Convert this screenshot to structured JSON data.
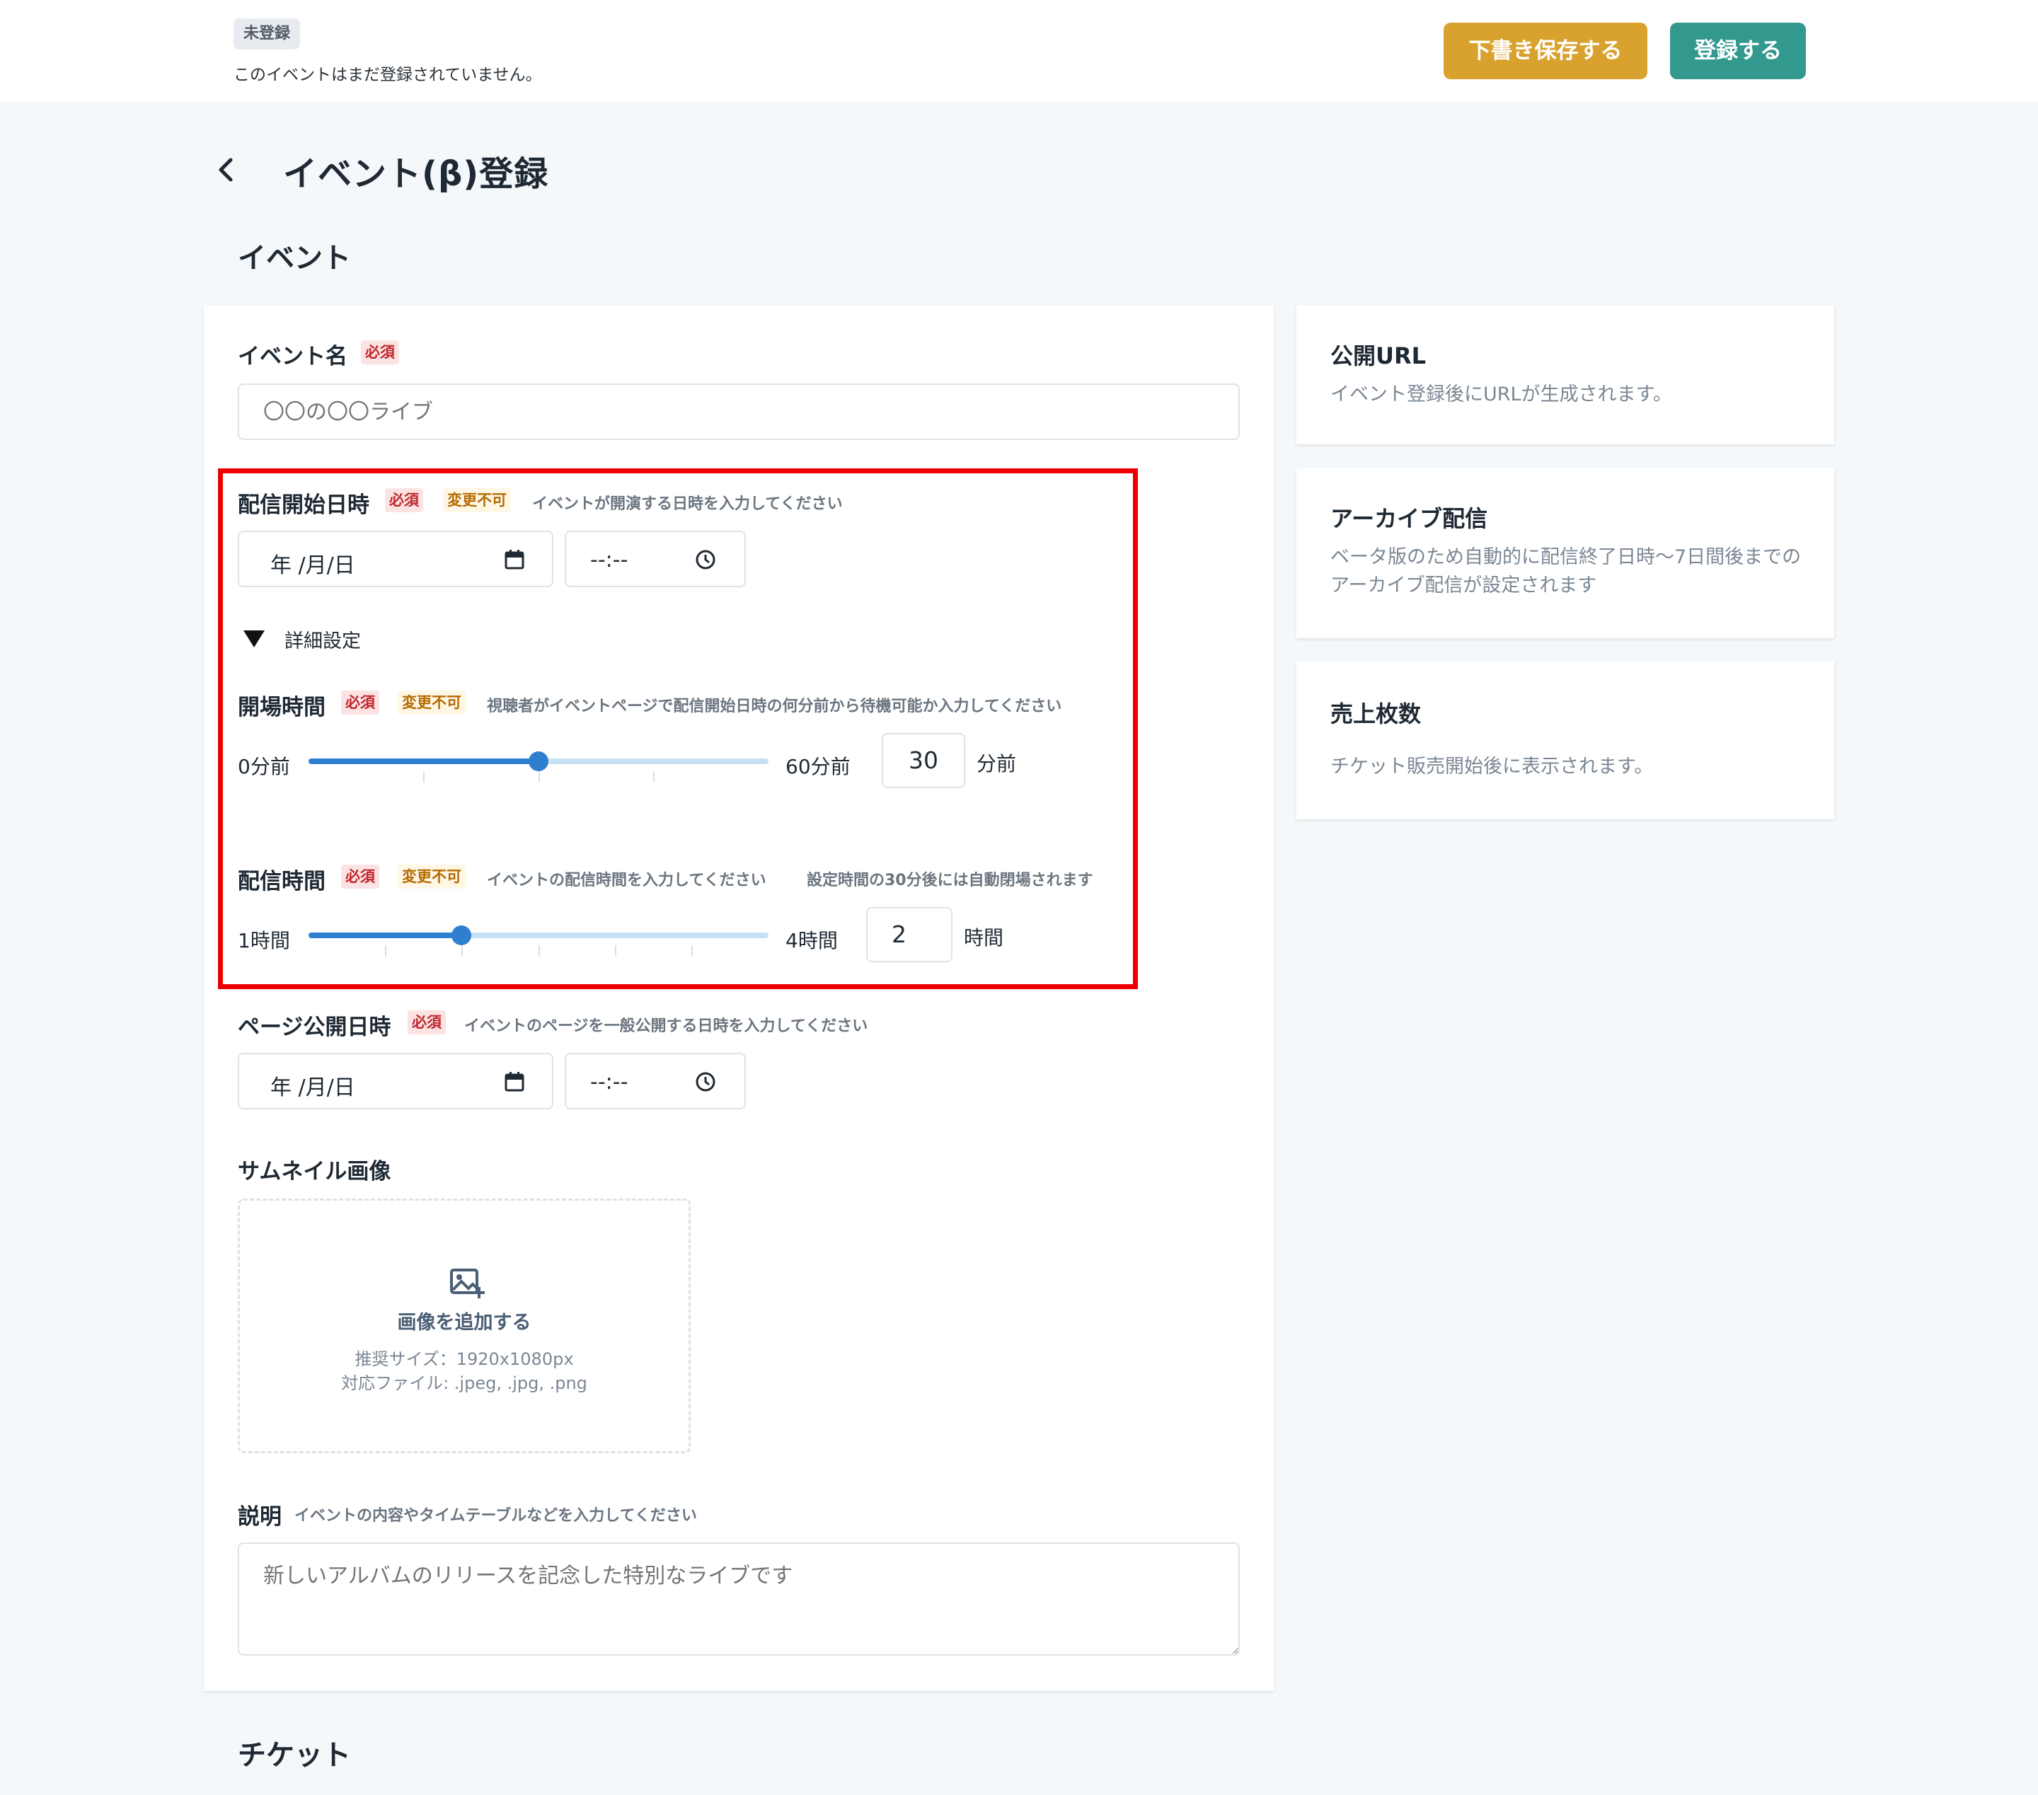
{
  "header": {
    "status_badge": "未登録",
    "status_text": "このイベントはまだ登録されていません。",
    "draft_button": "下書き保存する",
    "submit_button": "登録する"
  },
  "page": {
    "title": "イベント(β)登録",
    "section_event": "イベント",
    "section_ticket": "チケット"
  },
  "tags": {
    "required": "必須",
    "unchangeable": "変更不可"
  },
  "event_name": {
    "label": "イベント名",
    "placeholder": "〇〇の〇〇ライブ"
  },
  "start_datetime": {
    "label": "配信開始日時",
    "hint": "イベントが開演する日時を入力してください",
    "date_placeholder": "年 /月/日",
    "time_placeholder": "--:--"
  },
  "details": {
    "label": "詳細設定"
  },
  "opening_time": {
    "label": "開場時間",
    "hint": "視聴者がイベントページで配信開始日時の何分前から待機可能か入力してください",
    "min_label": "0分前",
    "max_label": "60分前",
    "value": "30",
    "unit": "分前",
    "fraction": 0.5
  },
  "stream_duration": {
    "label": "配信時間",
    "hint": "イベントの配信時間を入力してください",
    "hint2": "設定時間の30分後には自動閉場されます",
    "min_label": "1時間",
    "max_label": "4時間",
    "value": "2",
    "unit": "時間",
    "fraction": 0.333
  },
  "page_publish": {
    "label": "ページ公開日時",
    "hint": "イベントのページを一般公開する日時を入力してください",
    "date_placeholder": "年 /月/日",
    "time_placeholder": "--:--"
  },
  "thumbnail": {
    "label": "サムネイル画像",
    "add_label": "画像を追加する",
    "size_text": "推奨サイズ：1920x1080px",
    "types_text": "対応ファイル: .jpeg, .jpg, .png"
  },
  "description": {
    "label": "説明",
    "hint": "イベントの内容やタイムテーブルなどを入力してください",
    "placeholder": "新しいアルバムのリリースを記念した特別なライブです"
  },
  "sidebar": {
    "public_url": {
      "title": "公開URL",
      "text": "イベント登録後にURLが生成されます。"
    },
    "archive": {
      "title": "アーカイブ配信",
      "text": "ベータ版のため自動的に配信終了日時〜7日間後までのアーカイブ配信が設定されます"
    },
    "sales": {
      "title": "売上枚数",
      "text": "チケット販売開始後に表示されます。"
    }
  },
  "colors": {
    "accent_draft": "#d9a22e",
    "accent_submit": "#33998f",
    "slider": "#2f7fd0",
    "highlight": "#ee0000"
  }
}
